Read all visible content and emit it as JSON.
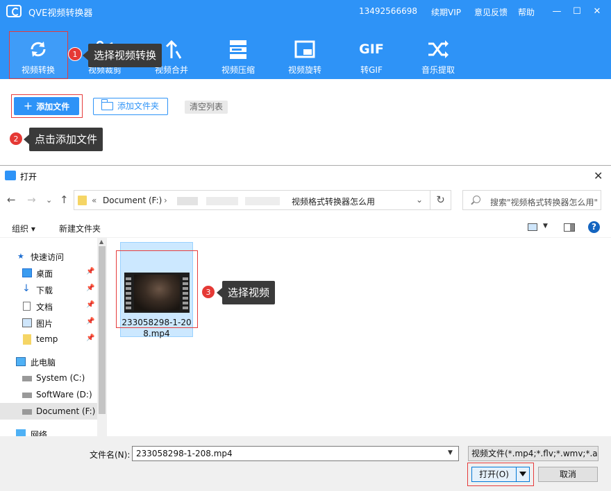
{
  "app": {
    "title": "QVE视频转换器",
    "phone": "13492566698",
    "renew_vip": "续期VIP",
    "feedback": "意见反馈",
    "help": "帮助",
    "min_glyph": "—",
    "max_glyph": "☐",
    "close_glyph": "✕"
  },
  "toolbar": {
    "items": [
      {
        "label": "视频转换",
        "icon": "convert-icon"
      },
      {
        "label": "视频裁剪",
        "icon": "scissors-icon"
      },
      {
        "label": "视频合并",
        "icon": "merge-icon"
      },
      {
        "label": "视频压缩",
        "icon": "compress-icon"
      },
      {
        "label": "视频旋转",
        "icon": "rotate-icon"
      },
      {
        "label": "转GIF",
        "icon": "gif-icon"
      },
      {
        "label": "音乐提取",
        "icon": "shuffle-icon"
      }
    ],
    "gif_glyph": "GIF"
  },
  "actions": {
    "add_file": "添加文件",
    "add_file_glyph": "+",
    "add_folder": "添加文件夹",
    "clear_list": "清空列表"
  },
  "callouts": [
    {
      "num": "1",
      "text": "选择视频转换"
    },
    {
      "num": "2",
      "text": "点击添加文件"
    },
    {
      "num": "3",
      "text": "选择视频"
    }
  ],
  "dialog": {
    "title": "打开",
    "close_glyph": "✕",
    "nav": {
      "back": "←",
      "forward": "→",
      "recent": "⌄",
      "up": "↑"
    },
    "address": {
      "chevrons": "«",
      "drive": "Document (F:)",
      "sep": "›",
      "folder": "视频格式转换器怎么用",
      "dropdown_glyph": "⌄"
    },
    "refresh_glyph": "↻",
    "search_placeholder": "搜索\"视频格式转换器怎么用\"",
    "organize": "组织 ▾",
    "new_folder": "新建文件夹",
    "view_dd_glyph": "▼",
    "help_glyph": "?",
    "nav_pane": [
      {
        "label": "快速访问",
        "icon": "star-icon",
        "pinned": false
      },
      {
        "label": "桌面",
        "icon": "desktop-icon",
        "pinned": true
      },
      {
        "label": "下载",
        "icon": "download-icon",
        "pinned": true
      },
      {
        "label": "文档",
        "icon": "document-icon",
        "pinned": true
      },
      {
        "label": "图片",
        "icon": "pictures-icon",
        "pinned": true
      },
      {
        "label": "temp",
        "icon": "folder-icon",
        "pinned": true
      },
      {
        "label": "此电脑",
        "icon": "computer-icon",
        "pinned": false
      },
      {
        "label": "System (C:)",
        "icon": "drive-icon",
        "pinned": false
      },
      {
        "label": "SoftWare (D:)",
        "icon": "drive-icon",
        "pinned": false
      },
      {
        "label": "Document (F:)",
        "icon": "drive-icon",
        "pinned": false,
        "selected": true
      },
      {
        "label": "网络",
        "icon": "network-icon",
        "pinned": false
      }
    ],
    "pin_glyph": "📌",
    "file": {
      "name": "233058298-1-208.mp4"
    },
    "filename_label": "文件名(N):",
    "filename_value": "233058298-1-208.mp4",
    "filetype": "视频文件(*.mp4;*.flv;*.wmv;*.a",
    "open_button": "打开(O)",
    "cancel_button": "取消"
  },
  "colors": {
    "brand": "#2e93f7",
    "callout_bg": "#3a3a3a",
    "step_badge": "#e53935",
    "highlight": "#e63b3b"
  }
}
